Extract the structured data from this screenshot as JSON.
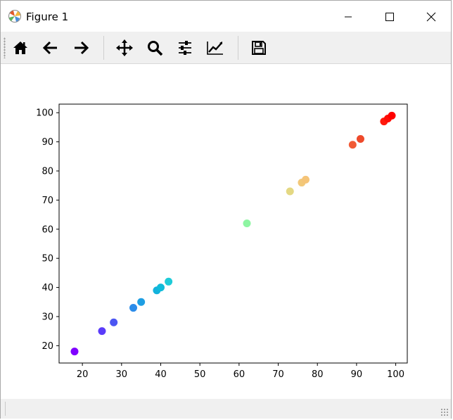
{
  "window": {
    "title": "Figure 1",
    "controls": {
      "minimize": "minimize-icon",
      "maximize": "maximize-icon",
      "close": "close-icon"
    }
  },
  "toolbar": {
    "items": [
      {
        "id": "home",
        "icon": "home-icon"
      },
      {
        "id": "back",
        "icon": "arrow-left-icon"
      },
      {
        "id": "forward",
        "icon": "arrow-right-icon"
      },
      {
        "id": "pan",
        "icon": "move-icon"
      },
      {
        "id": "zoom",
        "icon": "magnifier-icon"
      },
      {
        "id": "subplots",
        "icon": "sliders-icon"
      },
      {
        "id": "edit",
        "icon": "line-chart-icon"
      },
      {
        "id": "save",
        "icon": "floppy-disk-icon"
      }
    ]
  },
  "statusbar": {
    "text": ""
  },
  "chart_data": {
    "type": "scatter",
    "x": [
      18,
      25,
      28,
      33,
      35,
      39,
      40,
      42,
      62,
      73,
      76,
      77,
      89,
      91,
      97,
      98,
      99
    ],
    "y": [
      18,
      25,
      28,
      33,
      35,
      39,
      40,
      42,
      62,
      73,
      76,
      77,
      89,
      91,
      97,
      98,
      99
    ],
    "point_colors": [
      "#7f00ff",
      "#5a3bfa",
      "#4b55f2",
      "#2c8cea",
      "#1e9ee3",
      "#13b2dc",
      "#0ebbd9",
      "#1ecbd8",
      "#8ef5a2",
      "#e4d883",
      "#f2c879",
      "#f5c478",
      "#f15a35",
      "#ee4a2b",
      "#ff1a0d",
      "#ff0d07",
      "#ff0000"
    ],
    "colormap": "rainbow",
    "title": "",
    "xlabel": "",
    "ylabel": "",
    "xlim": [
      14.05,
      102.95
    ],
    "ylim": [
      14.05,
      102.95
    ],
    "xticks": [
      20,
      30,
      40,
      50,
      60,
      70,
      80,
      90,
      100
    ],
    "yticks": [
      20,
      30,
      40,
      50,
      60,
      70,
      80,
      90,
      100
    ],
    "grid": false,
    "legend": "none"
  }
}
